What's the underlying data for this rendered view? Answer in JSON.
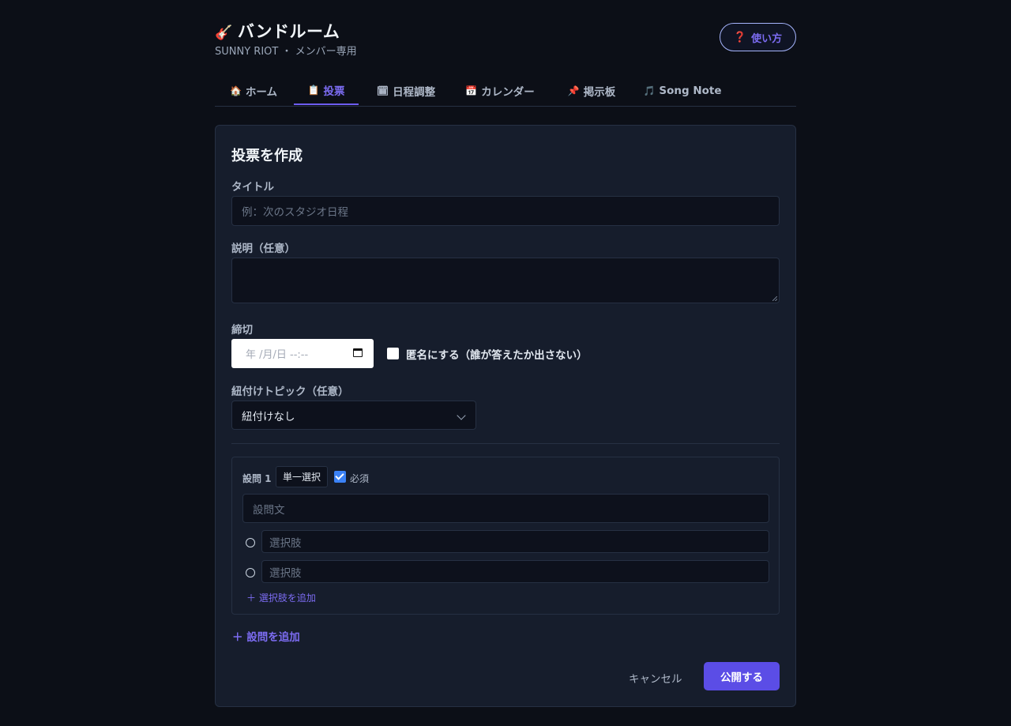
{
  "app": {
    "logo_icon": "guitar-icon",
    "title": "バンドルーム",
    "subtitle": "SUNNY RIOT ・ メンバー専用",
    "help_label": "使い方"
  },
  "tabs": [
    {
      "icon": "🏠",
      "label": "ホーム"
    },
    {
      "icon": "📋",
      "label": "投票",
      "active": true
    },
    {
      "icon": "🗓",
      "label": "日程調整"
    },
    {
      "icon": "📅",
      "label": "カレンダー"
    },
    {
      "icon": "📌",
      "label": "掲示板"
    },
    {
      "icon": "🎵",
      "label": "Song Note"
    }
  ],
  "form": {
    "heading": "投票を作成",
    "title_label": "タイトル",
    "title_placeholder": "例：次のスタジオ日程",
    "desc_label": "説明（任意）",
    "deadline_label": "締切",
    "deadline_placeholder": "年 /月/日 --:--",
    "anonymous_label": "匿名にする（誰が答えたか出さない）",
    "topic_label": "紐付けトピック（任意）",
    "topic_value": "紐付けなし",
    "question": {
      "number_label": "設問 1",
      "type_label": "単一選択",
      "required_label": "必須",
      "text_placeholder": "設問文",
      "options": [
        "選択肢",
        "選択肢"
      ],
      "add_option_label": "＋ 選択肢を追加"
    },
    "add_question_label": "＋ 設問を追加",
    "cancel_label": "キャンセル",
    "publish_label": "公開する"
  },
  "colors": {
    "accent": "#5b4de6",
    "background": "#0c0f17",
    "card": "#161d2c"
  }
}
